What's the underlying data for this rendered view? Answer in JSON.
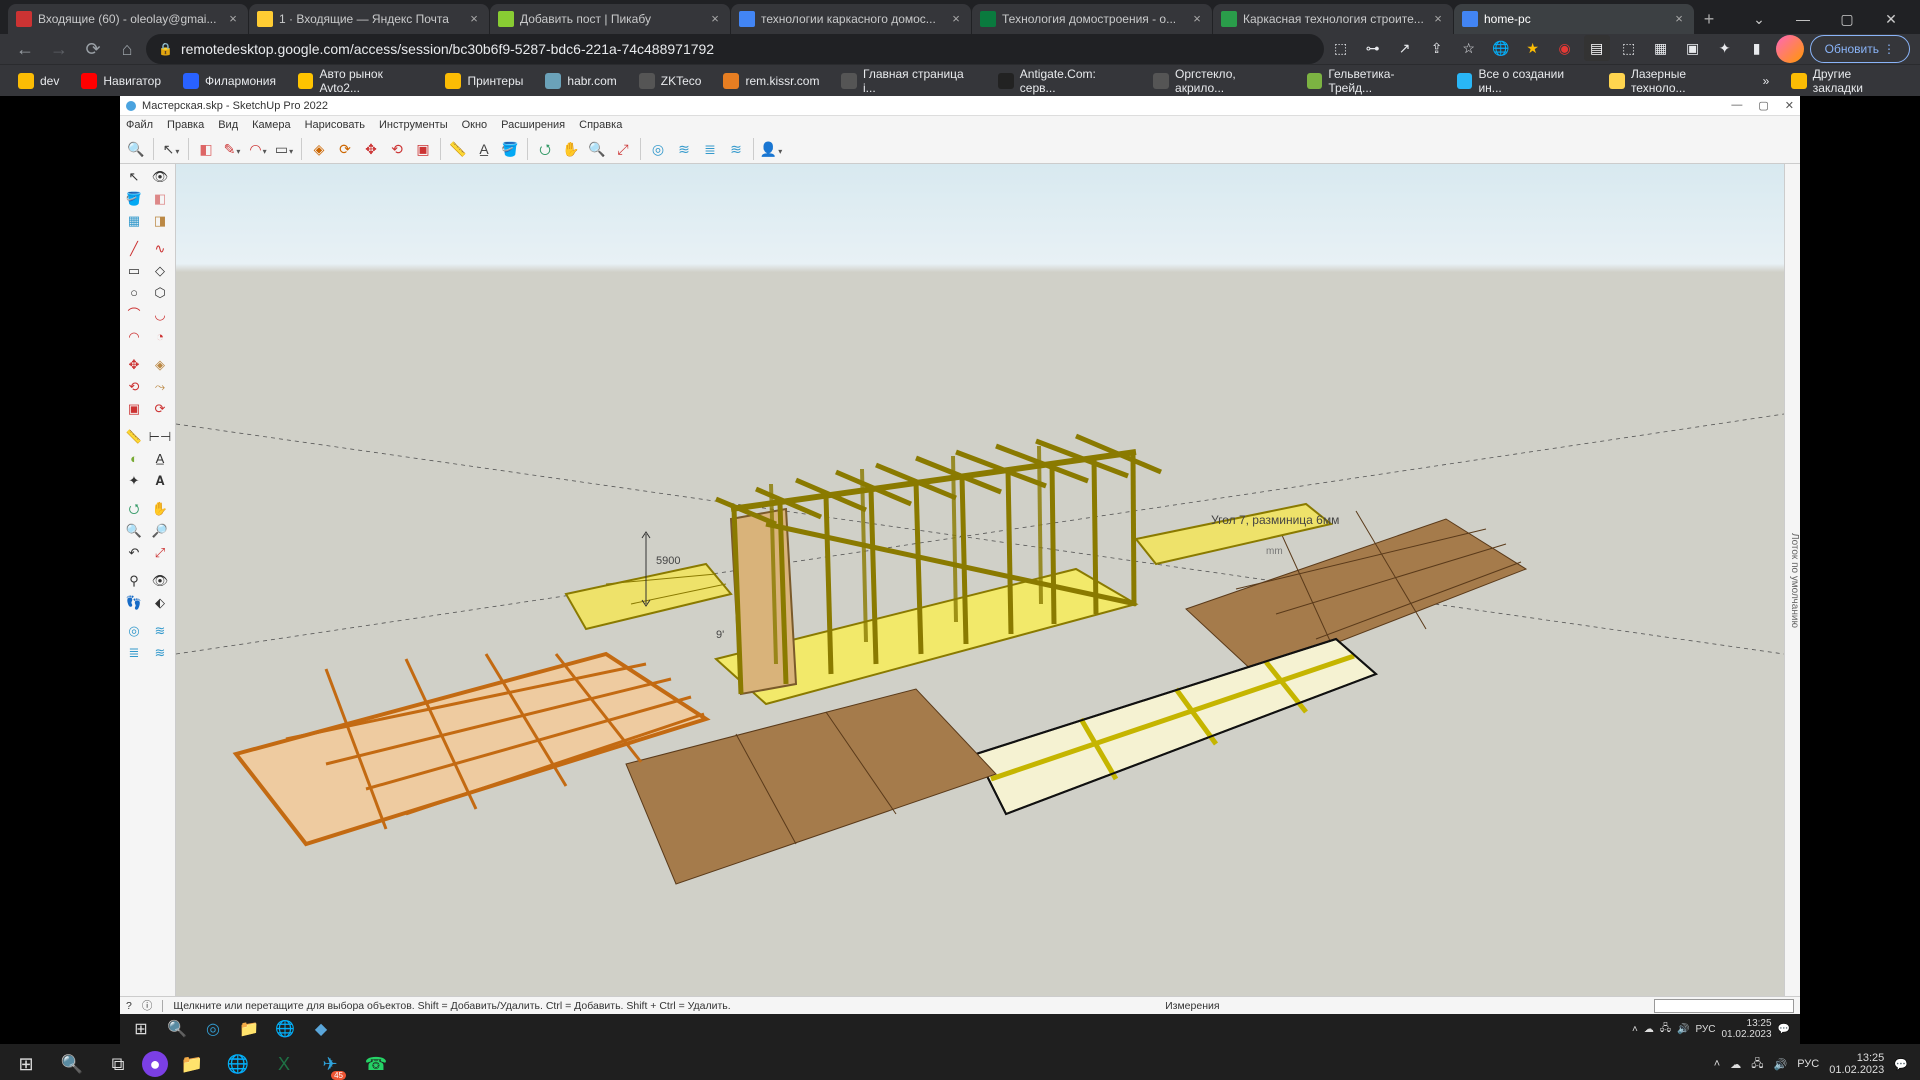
{
  "browser": {
    "tabs": [
      {
        "title": "Входящие (60) - oleolay@gmai...",
        "favcolor": "#c33"
      },
      {
        "title": "1 · Входящие — Яндекс Почта",
        "favcolor": "#fc3"
      },
      {
        "title": "Добавить пост | Пикабу",
        "favcolor": "#8c3"
      },
      {
        "title": "технологии каркасного домос...",
        "favcolor": "#4285f4"
      },
      {
        "title": "Технология домостроения - о...",
        "favcolor": "#0a7a3e"
      },
      {
        "title": "Каркасная технология строите...",
        "favcolor": "#2a9d4a"
      },
      {
        "title": "home-pc",
        "favcolor": "#4285f4",
        "active": true
      }
    ],
    "url": "remotedesktop.google.com/access/session/bc30b6f9-5287-bdc6-221a-74c488971792",
    "update_label": "Обновить",
    "bookmarks": [
      {
        "label": "dev",
        "color": "#fbbc04"
      },
      {
        "label": "Навигатор",
        "color": "#ff0000"
      },
      {
        "label": "Филармония",
        "color": "#2962ff"
      },
      {
        "label": "Авто рынок Avto2...",
        "color": "#ffc400"
      },
      {
        "label": "Принтеры",
        "color": "#fbbc04"
      },
      {
        "label": "habr.com",
        "color": "#6ba2b9"
      },
      {
        "label": "ZKTeco",
        "color": "#555"
      },
      {
        "label": "rem.kissr.com",
        "color": "#e67e22"
      },
      {
        "label": "Главная страница i...",
        "color": "#555"
      },
      {
        "label": "Antigate.Com: серв...",
        "color": "#222"
      },
      {
        "label": "Оргстекло, акрило...",
        "color": "#555"
      },
      {
        "label": "Гельветика-Трейд...",
        "color": "#7cb342"
      },
      {
        "label": "Все о создании ин...",
        "color": "#29b6f6"
      },
      {
        "label": "Лазерные техноло...",
        "color": "#ffd54f"
      }
    ],
    "other_bookmarks": "Другие закладки"
  },
  "sketchup": {
    "title": "Мастерская.skp - SketchUp Pro 2022",
    "menus": [
      "Файл",
      "Правка",
      "Вид",
      "Камера",
      "Нарисовать",
      "Инструменты",
      "Окно",
      "Расширения",
      "Справка"
    ],
    "status_hint": "Щелкните или перетащите для выбора объектов. Shift = Добавить/Удалить. Ctrl = Добавить. Shift + Ctrl = Удалить.",
    "measure_label": "Измерения",
    "right_tray": "Лоток по умолчанию",
    "annotation": "Угол 7, разминица 6мм",
    "dims": {
      "a": "5900",
      "b": "9'",
      "c": "mm"
    }
  },
  "inner_taskbar": {
    "time": "13:25",
    "date": "01.02.2023",
    "lang": "РУС"
  },
  "outer_taskbar": {
    "time": "13:25",
    "date": "01.02.2023",
    "lang": "РУС",
    "badge": "45"
  }
}
